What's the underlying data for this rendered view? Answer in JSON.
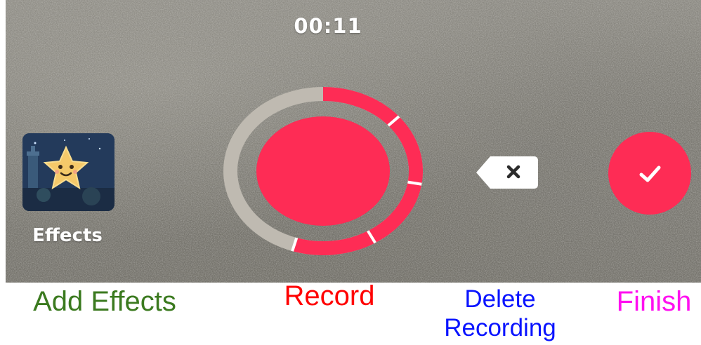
{
  "recording": {
    "timer": "00:11",
    "progress_fraction": 0.55,
    "segment_marks": 4
  },
  "effects_button": {
    "label": "Effects",
    "icon": "star-character-thumbnail"
  },
  "record_button": {
    "icon": "record-circle"
  },
  "delete_button": {
    "icon": "backspace-x-icon"
  },
  "finish_button": {
    "icon": "checkmark-icon"
  },
  "annotations": {
    "add_effects": "Add Effects",
    "record": "Record",
    "delete_line1": "Delete",
    "delete_line2": "Recording",
    "finish": "Finish"
  },
  "colors": {
    "accent": "#fe2c55",
    "ring_track": "#bfbab1",
    "annotation_effects": "#3b7a1f",
    "annotation_record": "#ff0000",
    "annotation_delete": "#0a14ff",
    "annotation_finish": "#ff10f0"
  }
}
